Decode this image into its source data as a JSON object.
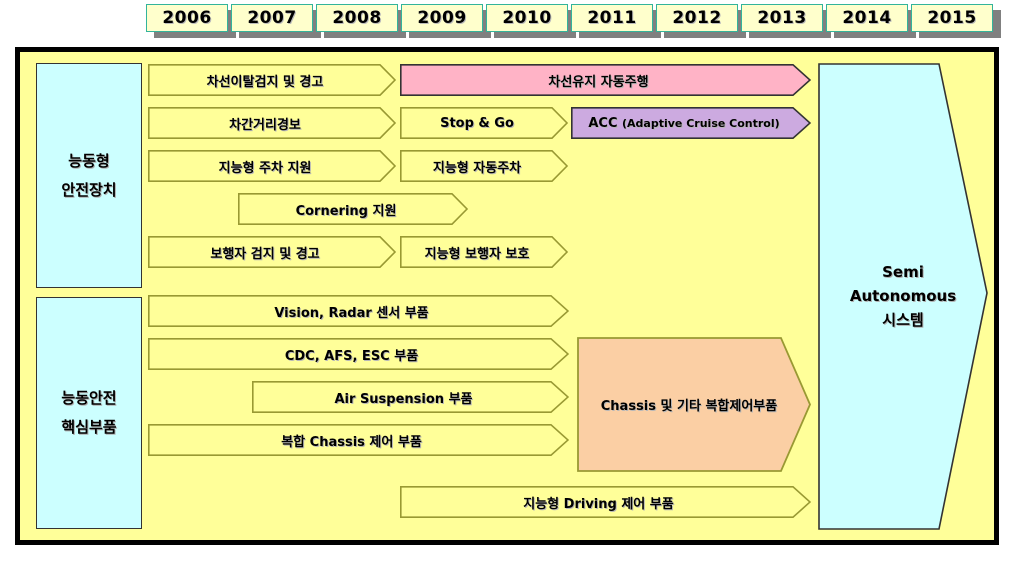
{
  "timeline": {
    "years": [
      "2006",
      "2007",
      "2008",
      "2009",
      "2010",
      "2011",
      "2012",
      "2013",
      "2014",
      "2015"
    ]
  },
  "categories": [
    {
      "line1": "능동형",
      "line2": "안전장치"
    },
    {
      "line1": "능동안전",
      "line2": "핵심부품"
    }
  ],
  "rows_top": [
    {
      "label": "차선이탈검지 및 경고"
    },
    {
      "label": "차선유지 자동주행"
    },
    {
      "label": "차간거리경보"
    },
    {
      "label": "Stop & Go"
    },
    {
      "label": "ACC ",
      "sublabel": "(Adaptive Cruise Control)"
    },
    {
      "label": "지능형 주차 지원"
    },
    {
      "label": "지능형 자동주차"
    },
    {
      "label": "Cornering 지원"
    },
    {
      "label": "보행자 검지 및 경고"
    },
    {
      "label": "지능형 보행자 보호"
    }
  ],
  "rows_bottom": [
    {
      "label": "Vision, Radar 센서 부품"
    },
    {
      "label": "CDC, AFS, ESC 부품"
    },
    {
      "label": "Air Suspension 부품"
    },
    {
      "label": "복합 Chassis 제어 부품"
    },
    {
      "label": "지능형 Driving 제어 부품"
    },
    {
      "label": "Chassis 및 기타 복합제어부품"
    }
  ],
  "outcome": {
    "line1": "Semi",
    "line2": "Autonomous",
    "line3": "시스템"
  },
  "colors": {
    "frame_fill": "#ffff99",
    "frame_border": "#000000",
    "year_fill": "#ffffcc",
    "year_border": "#33b49b",
    "year_shadow": "#808080",
    "category_fill": "#ccffff",
    "arrow_fill": "#ffff99",
    "arrow_border": "#999933",
    "highlight_pink": "#ffb3c6",
    "highlight_purple": "#ccaae0",
    "highlight_orange": "#fbcfa4",
    "outcome_fill": "#ccffff"
  }
}
